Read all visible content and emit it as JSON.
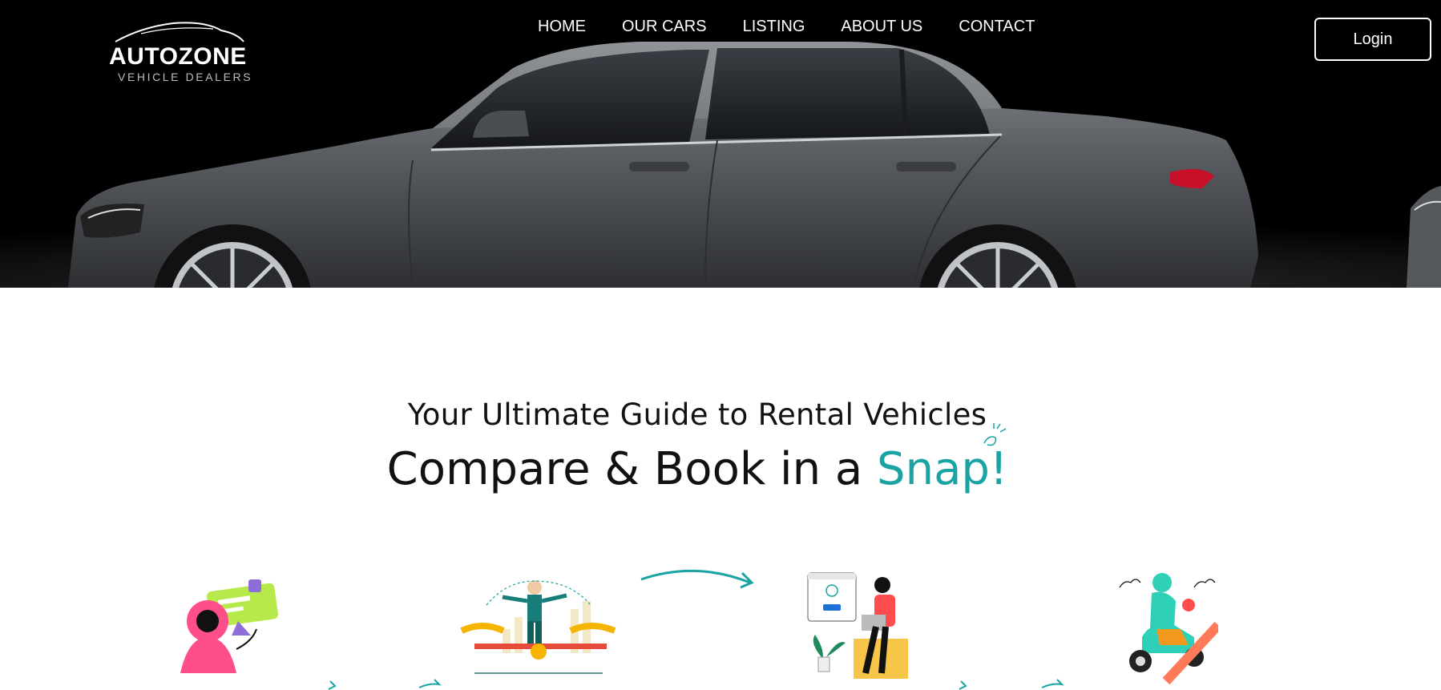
{
  "header": {
    "logo": {
      "brand": "AUTOZONE",
      "tagline": "VEHICLE DEALERS"
    },
    "nav": [
      {
        "label": "HOME"
      },
      {
        "label": "OUR CARS"
      },
      {
        "label": "LISTING"
      },
      {
        "label": "ABOUT US"
      },
      {
        "label": "CONTACT"
      }
    ],
    "login_label": "Login"
  },
  "main": {
    "subtitle": "Your Ultimate Guide to Rental Vehicles",
    "title_prefix": "Compare & Book in a ",
    "title_accent": "Snap!",
    "accent_color": "#1aa3a3"
  },
  "steps": [
    {
      "icon": "person-browsing-media-illustration"
    },
    {
      "icon": "businessman-balance-scale-illustration"
    },
    {
      "icon": "person-booking-laptop-illustration"
    },
    {
      "icon": "scooter-rider-delivery-illustration"
    }
  ]
}
